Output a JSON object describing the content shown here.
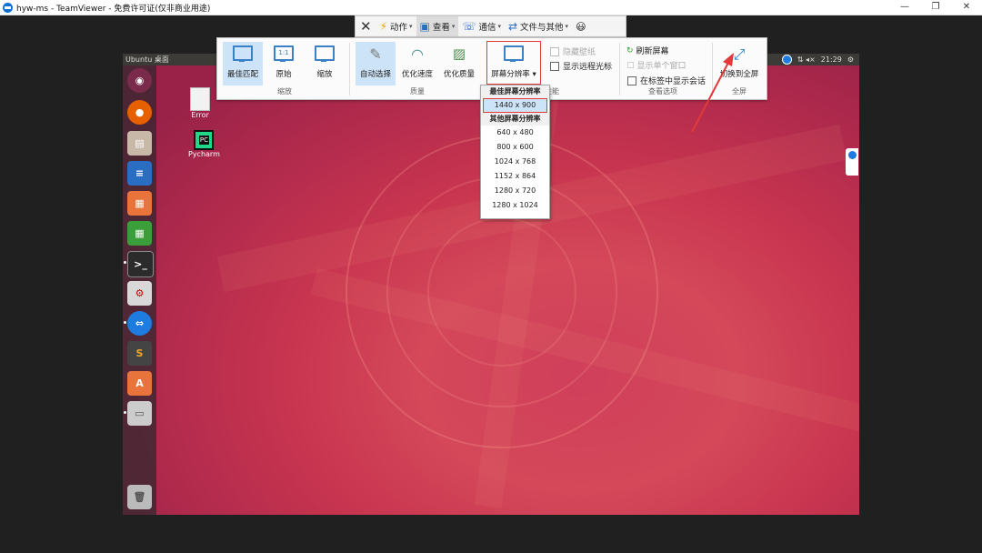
{
  "window": {
    "title": "hyw-ms - TeamViewer - 免费许可证(仅非商业用途)",
    "min": "—",
    "max": "❐",
    "close": "✕"
  },
  "toolbar": {
    "close_glyph": "✕",
    "items": [
      {
        "label": "动作",
        "icon": "lightning-icon"
      },
      {
        "label": "查看",
        "icon": "monitor-icon"
      },
      {
        "label": "通信",
        "icon": "phone-icon"
      },
      {
        "label": "文件与其他",
        "icon": "file-transfer-icon"
      }
    ],
    "emoji": "😃"
  },
  "ribbon": {
    "scale_group": {
      "label": "缩放",
      "buttons": [
        {
          "label": "最佳匹配",
          "icon": "best-fit-icon",
          "selected": true
        },
        {
          "label": "原始",
          "icon": "original-size-icon",
          "glyph": "1:1"
        },
        {
          "label": "缩放",
          "icon": "scale-icon"
        }
      ]
    },
    "quality_group": {
      "label": "质量",
      "buttons": [
        {
          "label": "自动选择",
          "icon": "magic-wand-icon",
          "selected": true
        },
        {
          "label": "优化速度",
          "icon": "speedometer-icon"
        },
        {
          "label": "优化质量",
          "icon": "image-quality-icon"
        }
      ]
    },
    "resolution_button": {
      "label": "屏幕分辨率",
      "caret": "▾"
    },
    "performance_label": "性能",
    "performance_checks": [
      {
        "label": "隐藏壁纸",
        "disabled": true
      },
      {
        "label": "显示远程光标",
        "disabled": false
      }
    ],
    "view_options": {
      "label": "查看选项",
      "items": [
        {
          "label": "刷新屏幕",
          "icon": "refresh-icon"
        },
        {
          "label": "显示单个窗口",
          "icon": "single-window-icon",
          "disabled": true
        },
        {
          "label": "在标签中显示会话",
          "checkbox": true
        }
      ]
    },
    "fullscreen": {
      "group_label": "全屏",
      "button_label": "切换到全屏"
    }
  },
  "dropdown": {
    "best_header": "最佳屏幕分辨率",
    "best_option": "1440 x 900",
    "other_header": "其他屏幕分辨率",
    "options": [
      "640 x 480",
      "800 x 600",
      "1024 x 768",
      "1152 x 864",
      "1280 x 720",
      "1280 x 1024"
    ]
  },
  "remote": {
    "top_title": "Ubuntu 桌面",
    "clock": "21:29",
    "indicators": "⇅  ◂×",
    "desktop_icons": [
      {
        "label": "Error"
      },
      {
        "label": "Pycharm",
        "badge": "PC"
      }
    ]
  },
  "colors": {
    "highlight_red": "#e23a3a",
    "selection_blue": "#cde3f7",
    "ubuntu_orange": "#d4485a"
  }
}
